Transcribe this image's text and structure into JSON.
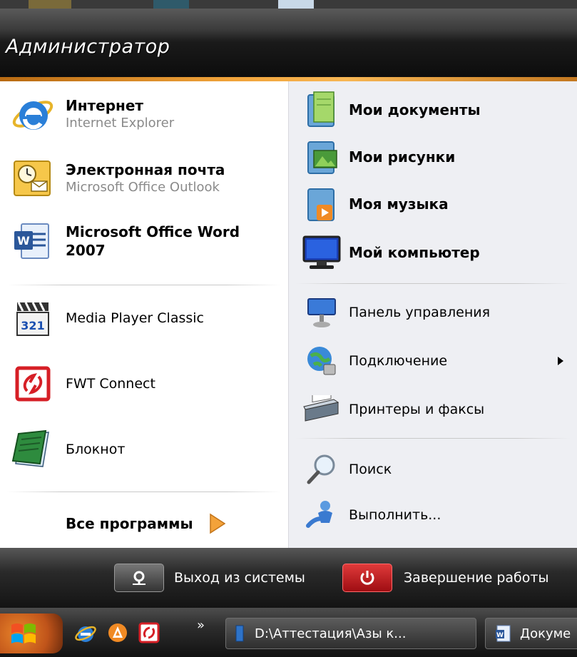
{
  "header": {
    "user_name": "Администратор"
  },
  "pinned": [
    {
      "title": "Интернет",
      "subtitle": "Internet Explorer",
      "icon": "internet-explorer-icon"
    },
    {
      "title": "Электронная почта",
      "subtitle": "Microsoft Office Outlook",
      "icon": "outlook-icon"
    },
    {
      "title_line1": "Microsoft Office Word",
      "title_line2": "2007",
      "icon": "word-icon"
    }
  ],
  "recent": [
    {
      "label": "Media Player Classic",
      "icon": "media-player-classic-icon"
    },
    {
      "label": "FWT Connect",
      "icon": "fwt-connect-icon"
    },
    {
      "label": "Блокнот",
      "icon": "notepad-icon"
    }
  ],
  "all_programs": {
    "label": "Все программы",
    "icon": "orange-arrow-icon"
  },
  "places": [
    {
      "label": "Мои документы",
      "icon": "my-documents-icon"
    },
    {
      "label": "Мои рисунки",
      "icon": "my-pictures-icon"
    },
    {
      "label": "Моя музыка",
      "icon": "my-music-icon"
    },
    {
      "label": "Мой компьютер",
      "icon": "my-computer-icon"
    }
  ],
  "system": [
    {
      "label": "Панель управления",
      "icon": "control-panel-icon"
    },
    {
      "label": "Подключение",
      "icon": "network-connect-icon",
      "submenu": true
    },
    {
      "label": "Принтеры и факсы",
      "icon": "printer-icon"
    },
    {
      "label": "Поиск",
      "icon": "search-icon"
    },
    {
      "label": "Выполнить...",
      "icon": "run-icon"
    }
  ],
  "footer": {
    "logoff": {
      "label": "Выход из системы",
      "icon": "logoff-key-icon"
    },
    "shutdown": {
      "label": "Завершение работы",
      "icon": "power-icon"
    }
  },
  "taskbar": {
    "start_icon": "windows-logo-icon",
    "quick_launch": [
      "ie-quicklaunch-icon",
      "avast-icon",
      "fwt-quicklaunch-icon"
    ],
    "more": "»",
    "tasks": [
      {
        "label": "D:\\Аттестация\\Азы к...",
        "icon": "book-icon"
      },
      {
        "label": "Докуме",
        "icon": "word-doc-icon"
      }
    ]
  },
  "colors": {
    "accent": "#f0a33a",
    "shutdown": "#c8161d",
    "right_pane": "#eeeff3"
  }
}
